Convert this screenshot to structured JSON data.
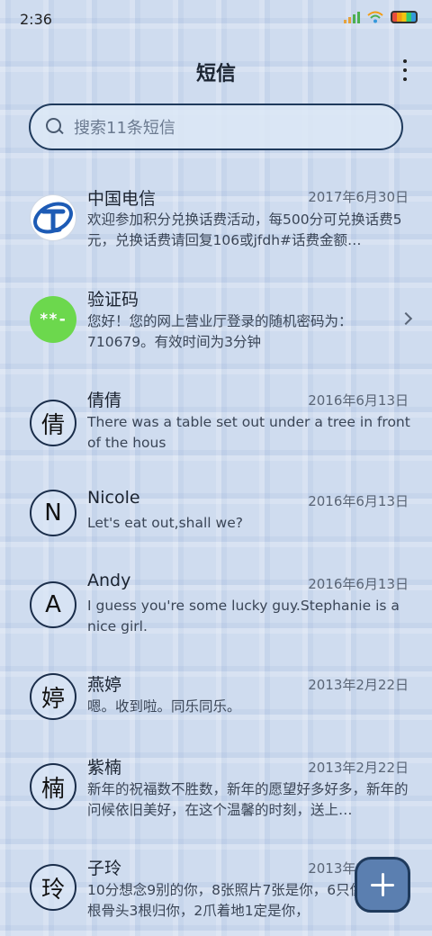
{
  "status_bar": {
    "time": "2:36"
  },
  "header": {
    "title": "短信"
  },
  "search": {
    "placeholder": "搜索11条短信"
  },
  "conversations": [
    {
      "name": "中国电信",
      "date": "2017年6月30日",
      "preview": "欢迎参加积分兑换话费活动，每500分可兑换话费5元，兑换话费请回复106或jfdh#话费金额…",
      "avatar": "telecom-logo"
    },
    {
      "name": "验证码",
      "date": "",
      "preview": "您好！您的网上营业厅登录的随机密码为：710679。有效时间为3分钟",
      "avatar": "**-"
    },
    {
      "name": "倩倩",
      "date": "2016年6月13日",
      "preview": "There was a table set out under a tree in front of the hous",
      "avatar": "倩"
    },
    {
      "name": "Nicole",
      "date": "2016年6月13日",
      "preview": "Let's eat out,shall we?",
      "avatar": "N"
    },
    {
      "name": "Andy",
      "date": "2016年6月13日",
      "preview": "I guess you're some lucky guy.Stephanie is a nice girl.",
      "avatar": "A"
    },
    {
      "name": "燕婷",
      "date": "2013年2月22日",
      "preview": "嗯。收到啦。同乐同乐。",
      "avatar": "婷"
    },
    {
      "name": "紫楠",
      "date": "2013年2月22日",
      "preview": "新年的祝福数不胜数，新年的愿望好多好多，新年的问候依旧美好，在这个温馨的时刻，送上…",
      "avatar": "楠"
    },
    {
      "name": "子玲",
      "date": "2013年2月22日",
      "preview": "10分想念9别的你，8张照片7张是你，6只像你，4根骨头3根归你，2爪着地1定是你，",
      "avatar": "玲"
    }
  ],
  "colors": {
    "accent": "#1f3a5c",
    "fab": "#5b7fb0",
    "code_avatar": "#6cd84d",
    "telecom_blue": "#1d5bb5"
  }
}
